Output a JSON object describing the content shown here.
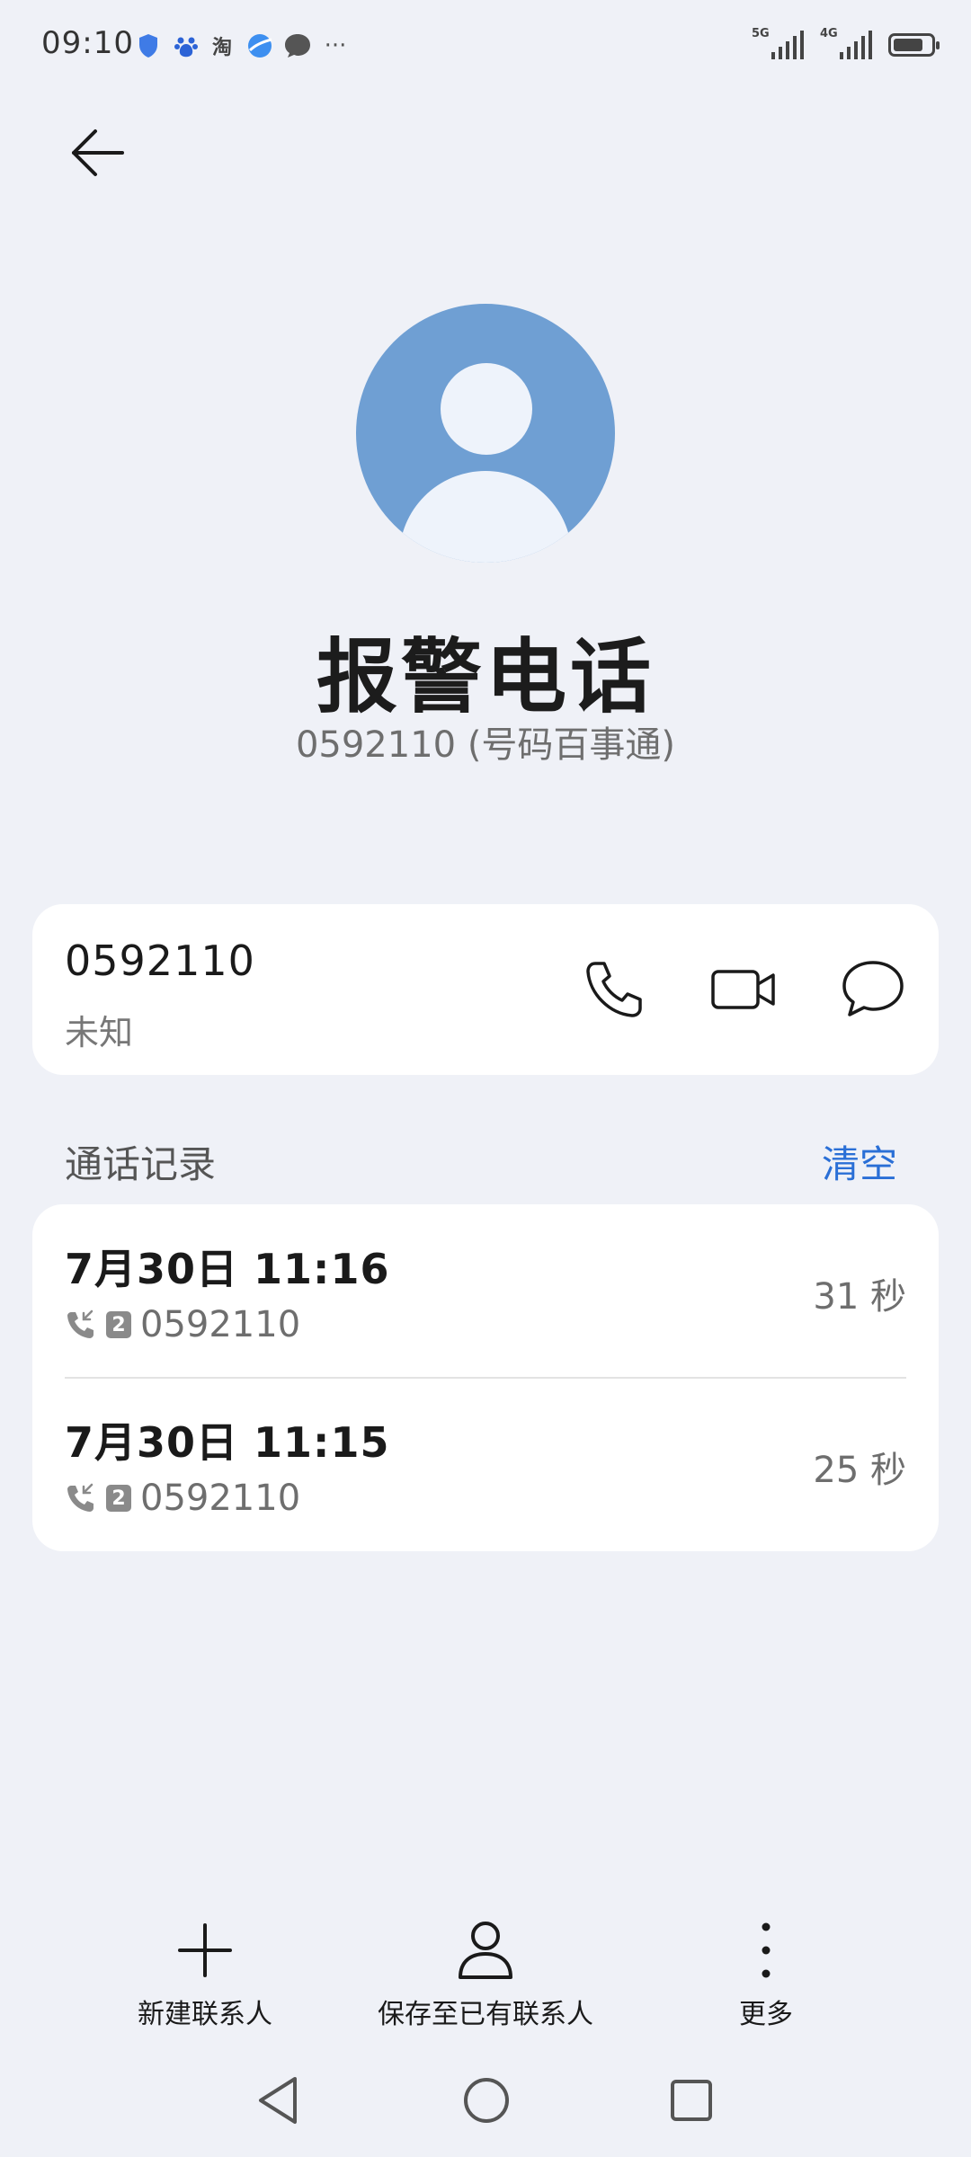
{
  "status_bar": {
    "time": "09:10",
    "taobao_label": "淘",
    "network_1": "5G",
    "network_2": "4G",
    "battery_level": 0.8
  },
  "contact": {
    "name": "报警电话",
    "subtitle": "0592110 (号码百事通)",
    "number": "0592110",
    "location": "未知"
  },
  "call_log": {
    "title": "通话记录",
    "clear_label": "清空",
    "entries": [
      {
        "time": "7月30日 11:16",
        "sim": "2",
        "number": "0592110",
        "duration": "31 秒"
      },
      {
        "time": "7月30日 11:15",
        "sim": "2",
        "number": "0592110",
        "duration": "25 秒"
      }
    ]
  },
  "bottom_actions": {
    "new_contact": "新建联系人",
    "save_existing": "保存至已有联系人",
    "more": "更多"
  },
  "colors": {
    "accent": "#2a6fd6",
    "avatar_bg": "#6f9fd3",
    "page_bg": "#eff1f7"
  }
}
